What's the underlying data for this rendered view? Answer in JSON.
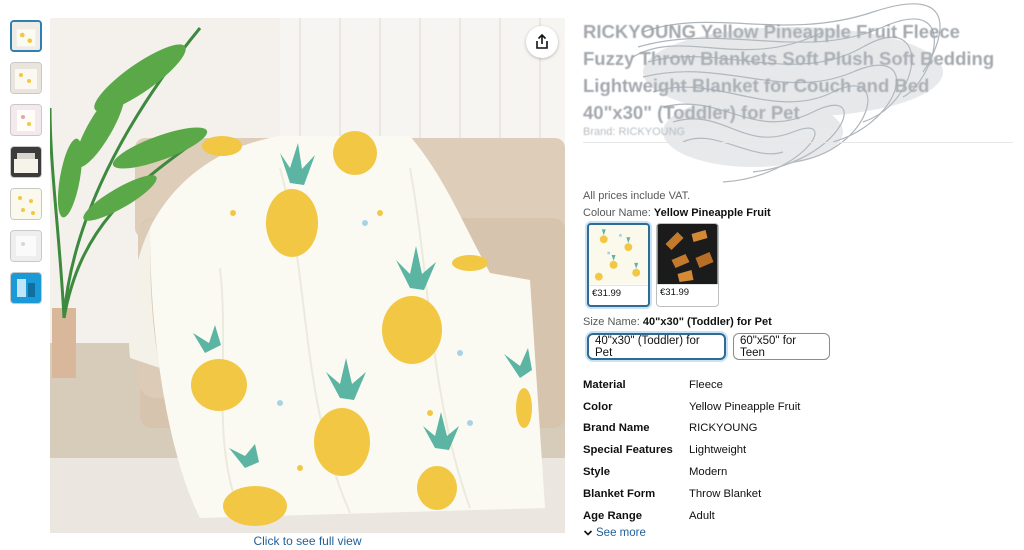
{
  "product": {
    "title": "RICKYOUNG Yellow Pineapple Fruit Fleece Fuzzy Throw Blankets Soft Plush Soft Bedding Lightweight Blanket for Couch and Bed 40\"x30\" (Toddler) for Pet",
    "brand_line": "Brand: RICKYOUNG"
  },
  "media": {
    "full_view_link": "Click to see full view",
    "share_icon": "share-icon"
  },
  "pricing": {
    "vat_note": "All prices include VAT."
  },
  "colour": {
    "label": "Colour Name:",
    "selected": "Yellow Pineapple Fruit",
    "swatches": [
      {
        "price": "€31.99"
      },
      {
        "price": "€31.99"
      }
    ]
  },
  "size": {
    "label": "Size Name:",
    "selected": "40\"x30\" (Toddler) for Pet",
    "options": [
      "40\"x30\" (Toddler) for Pet",
      "60\"x50\" for Teen"
    ]
  },
  "specs": [
    {
      "key": "Material",
      "value": "Fleece"
    },
    {
      "key": "Color",
      "value": "Yellow Pineapple Fruit"
    },
    {
      "key": "Brand Name",
      "value": "RICKYOUNG"
    },
    {
      "key": "Special Features",
      "value": "Lightweight"
    },
    {
      "key": "Style",
      "value": "Modern"
    },
    {
      "key": "Blanket Form",
      "value": "Throw Blanket"
    },
    {
      "key": "Age Range",
      "value": "Adult"
    }
  ],
  "see_more": "See more",
  "colors": {
    "link": "#1f5f99",
    "selected_border": "#2f6b93",
    "pineapple": "#f2c744",
    "leaf": "#5bb5a2"
  }
}
